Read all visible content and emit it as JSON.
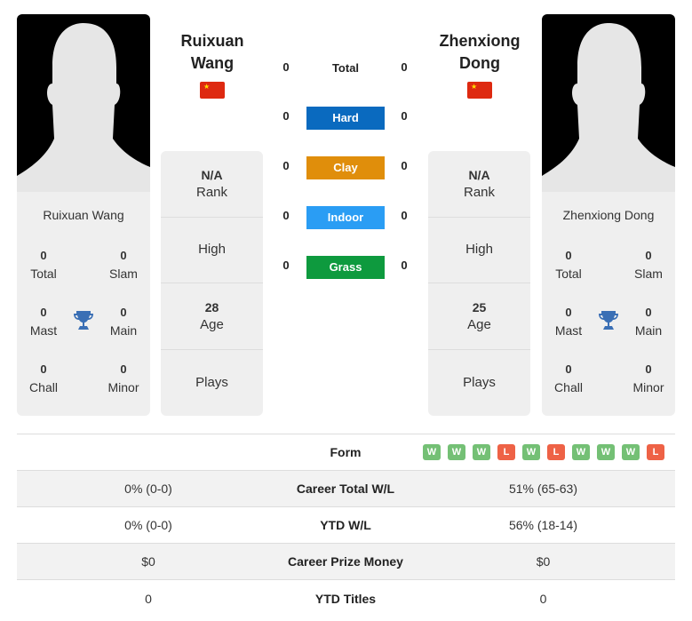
{
  "player1": {
    "name": "Ruixuan Wang",
    "title_line1": "Ruixuan",
    "title_line2": "Wang",
    "flag": "china-flag",
    "stats": {
      "total": {
        "value": "0",
        "label": "Total"
      },
      "slam": {
        "value": "0",
        "label": "Slam"
      },
      "mast": {
        "value": "0",
        "label": "Mast"
      },
      "main": {
        "value": "0",
        "label": "Main"
      },
      "chall": {
        "value": "0",
        "label": "Chall"
      },
      "minor": {
        "value": "0",
        "label": "Minor"
      }
    },
    "info": {
      "rank_value": "N/A",
      "rank_label": "Rank",
      "high_label": "High",
      "age_value": "28",
      "age_label": "Age",
      "plays_label": "Plays"
    }
  },
  "player2": {
    "name": "Zhenxiong Dong",
    "title_line1": "Zhenxiong",
    "title_line2": "Dong",
    "flag": "china-flag",
    "stats": {
      "total": {
        "value": "0",
        "label": "Total"
      },
      "slam": {
        "value": "0",
        "label": "Slam"
      },
      "mast": {
        "value": "0",
        "label": "Mast"
      },
      "main": {
        "value": "0",
        "label": "Main"
      },
      "chall": {
        "value": "0",
        "label": "Chall"
      },
      "minor": {
        "value": "0",
        "label": "Minor"
      }
    },
    "info": {
      "rank_value": "N/A",
      "rank_label": "Rank",
      "high_label": "High",
      "age_value": "25",
      "age_label": "Age",
      "plays_label": "Plays"
    }
  },
  "h2h": {
    "total": {
      "label": "Total",
      "p1": "0",
      "p2": "0"
    },
    "surfaces": [
      {
        "label": "Hard",
        "p1": "0",
        "p2": "0",
        "color": "#0a6abf"
      },
      {
        "label": "Clay",
        "p1": "0",
        "p2": "0",
        "color": "#e08e0b"
      },
      {
        "label": "Indoor",
        "p1": "0",
        "p2": "0",
        "color": "#2a9df4"
      },
      {
        "label": "Grass",
        "p1": "0",
        "p2": "0",
        "color": "#0e9a3e"
      }
    ]
  },
  "comparison": {
    "form_label": "Form",
    "p2_form": [
      "W",
      "W",
      "W",
      "L",
      "W",
      "L",
      "W",
      "W",
      "W",
      "L"
    ],
    "rows": [
      {
        "label": "Career Total W/L",
        "p1": "0% (0-0)",
        "p2": "51% (65-63)"
      },
      {
        "label": "YTD W/L",
        "p1": "0% (0-0)",
        "p2": "56% (18-14)"
      },
      {
        "label": "Career Prize Money",
        "p1": "$0",
        "p2": "$0"
      },
      {
        "label": "YTD Titles",
        "p1": "0",
        "p2": "0"
      }
    ]
  }
}
